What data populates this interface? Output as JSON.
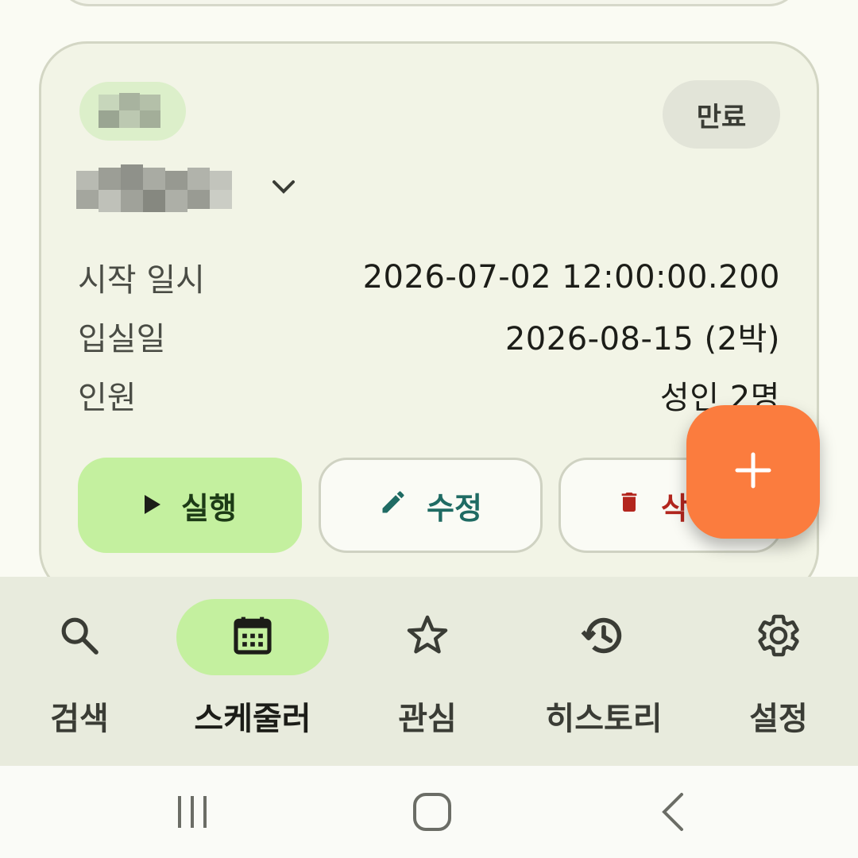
{
  "reservation": {
    "status": "만료",
    "details": [
      {
        "label": "시작 일시",
        "value": "2026-07-02 12:00:00.200"
      },
      {
        "label": "입실일",
        "value": "2026-08-15 (2박)"
      },
      {
        "label": "인원",
        "value": "성인 2명"
      }
    ],
    "actions": {
      "run": "실행",
      "edit": "수정",
      "delete": "삭"
    }
  },
  "nav": {
    "items": [
      {
        "label": "검색",
        "icon": "search-icon"
      },
      {
        "label": "스케줄러",
        "icon": "calendar-icon",
        "active": true
      },
      {
        "label": "관심",
        "icon": "star-icon"
      },
      {
        "label": "히스토리",
        "icon": "history-icon"
      },
      {
        "label": "설정",
        "icon": "gear-icon"
      }
    ]
  },
  "colors": {
    "accent_green": "#c4f09f",
    "fab_orange": "#fb7c3e",
    "edit_teal": "#1f6b63",
    "delete_red": "#b3261e"
  }
}
